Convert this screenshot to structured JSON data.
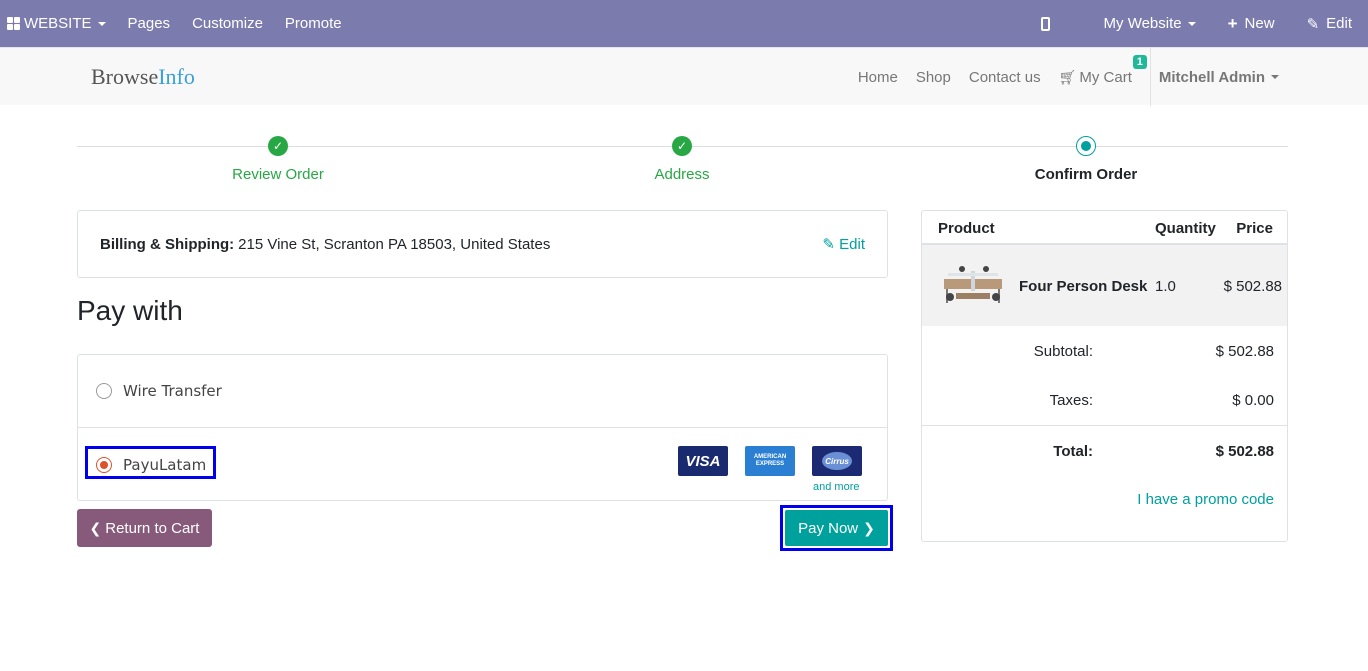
{
  "admin_bar": {
    "website_label": "WEBSITE",
    "pages_label": "Pages",
    "customize_label": "Customize",
    "promote_label": "Promote",
    "my_website_label": "My Website",
    "new_label": "New",
    "edit_label": "Edit"
  },
  "navbar": {
    "brand_part1": "Browse",
    "brand_part2": "Info",
    "links": [
      "Home",
      "Shop",
      "Contact us"
    ],
    "cart_label": "My Cart",
    "cart_count": "1",
    "user_name": "Mitchell Admin"
  },
  "wizard": {
    "steps": [
      {
        "label": "Review Order",
        "state": "done"
      },
      {
        "label": "Address",
        "state": "done"
      },
      {
        "label": "Confirm Order",
        "state": "current"
      }
    ]
  },
  "billing": {
    "label": "Billing & Shipping:",
    "address": "215 Vine St, Scranton PA 18503, United States",
    "edit_label": "Edit"
  },
  "pay_with_title": "Pay with",
  "payment_methods": [
    {
      "name": "Wire Transfer",
      "selected": false
    },
    {
      "name": "PayuLatam",
      "selected": true
    }
  ],
  "cards": {
    "visa": "VISA",
    "amex": "AMERICAN EXPRESS",
    "cirrus": "Cirrus",
    "and_more": "and more"
  },
  "buttons": {
    "return_label": "Return to Cart",
    "pay_label": "Pay Now"
  },
  "summary": {
    "headers": {
      "product": "Product",
      "quantity": "Quantity",
      "price": "Price"
    },
    "item": {
      "name": "Four Person Desk",
      "quantity": "1.0",
      "price": "$ 502.88"
    },
    "subtotal_label": "Subtotal:",
    "subtotal_value": "$ 502.88",
    "taxes_label": "Taxes:",
    "taxes_value": "$ 0.00",
    "total_label": "Total:",
    "total_value": "$ 502.88",
    "promo_label": "I have a promo code"
  },
  "colors": {
    "admin_bar": "#7c7bad",
    "primary": "#00a09d",
    "success": "#28a745",
    "return_button": "#875a7b",
    "highlight": "#0000ee"
  }
}
